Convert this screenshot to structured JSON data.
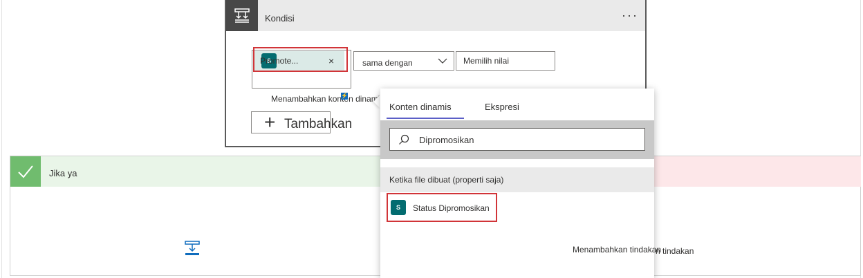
{
  "condition": {
    "title": "Kondisi",
    "menu": "···",
    "token": {
      "label": "Promote...",
      "remove": "×",
      "icon": "sharepoint-icon"
    },
    "operator": {
      "selected": "sama dengan"
    },
    "value_input": {
      "placeholder": "Memilih nilai"
    },
    "add_dynamic_link": "Menambahkan konten dinamis",
    "add_button": "Tambahkan"
  },
  "yes_branch": {
    "title": "Jika ya"
  },
  "background_action_text": "n tindakan",
  "popup": {
    "tabs": [
      {
        "label": "Konten dinamis",
        "active": true
      },
      {
        "label": "Ekspresi",
        "active": false
      }
    ],
    "search": {
      "value": "Dipromosikan"
    },
    "section": "Ketika file dibuat (properti saja)",
    "items": [
      {
        "label": "Status Dipromosikan",
        "icon": "sharepoint-icon"
      }
    ]
  },
  "add_action": "Menambahkan tindakan",
  "colors": {
    "accent": "#5b5fc7",
    "highlight": "#d13438",
    "sharepoint": "#036c70",
    "yes_green": "#70bc6e",
    "condition_dark": "#484848"
  }
}
